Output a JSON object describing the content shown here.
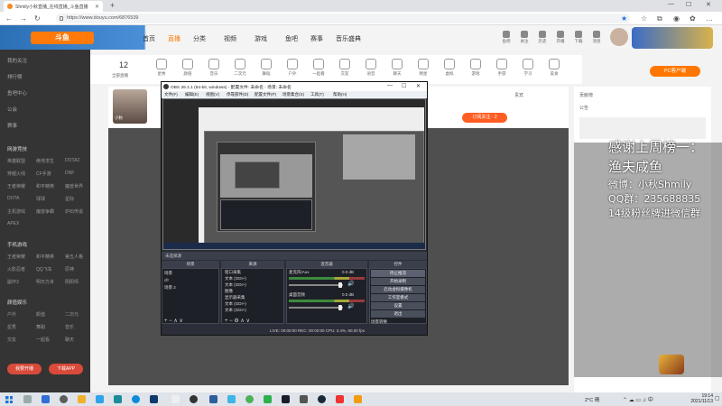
{
  "browser": {
    "tab_title": "Shmily小秋直播_在线直播_斗鱼直播",
    "url": "https://www.douyu.com/6876539"
  },
  "site": {
    "logo": "斗鱼",
    "nav": [
      "首页",
      "直播",
      "分类",
      "视频",
      "游戏",
      "鱼吧",
      "赛事",
      "音乐盛典"
    ],
    "search_placeholder": "",
    "header_icons": [
      "鱼吧",
      "关注",
      "历史",
      "开播",
      "下载",
      "消息"
    ],
    "pc_client_button": "PC客户端"
  },
  "sidebar": {
    "items": [
      "我的关注",
      "排行榜",
      "鱼吧中心",
      "公会",
      "赛事"
    ],
    "section1_title": "网游竞技",
    "section1_grid": [
      "英雄联盟",
      "绝地求生",
      "DOTA2",
      "穿越火线",
      "CF手游",
      "DNF",
      "王者荣耀",
      "和平精英",
      "魔兽世界",
      "DOTA",
      "球球",
      "星际",
      "主机游戏",
      "魔兽争霸",
      "炉石传说",
      "APEX"
    ],
    "section2_title": "手机游戏",
    "section2_grid": [
      "王者荣耀",
      "和平精英",
      "第五人格",
      "火影忍者",
      "QQ飞车",
      "原神",
      "崩坏3",
      "明日方舟",
      "阴阳师"
    ],
    "section3_title": "颜值娱乐",
    "section3_grid": [
      "户外",
      "颜值",
      "二次元",
      "星秀",
      "舞蹈",
      "音乐",
      "交友",
      "一起看",
      "聊天"
    ],
    "button_left": "我要开播",
    "button_right": "下载APP"
  },
  "category_bar": {
    "live_count": "12",
    "live_label": "全部直播",
    "items": [
      "星秀",
      "颜值",
      "音乐",
      "二次元",
      "舞蹈",
      "户外",
      "一起看",
      "交友",
      "语音",
      "聊天",
      "明星",
      "虚拟",
      "游戏",
      "手游",
      "学习",
      "美食",
      "科技"
    ]
  },
  "room": {
    "avatar_label": "小秋",
    "follow_button": "订阅关注 · 2",
    "rank_label": "贵宾",
    "top_fans_label": "贡献榜",
    "notice_label": "公告"
  },
  "overlay_text": [
    "感谢上周榜一：",
    "渔夫咸鱼",
    "微博：小秋Shmily",
    "QQ群：235688835",
    "14级粉丝牌进微信群"
  ],
  "obs": {
    "title": "OBS 26.1.1 (64-bit, windows) - 配置文件: 未命名 - 场景: 未命名",
    "menu": [
      "文件(F)",
      "编辑(E)",
      "视图(V)",
      "停靠部件(D)",
      "配置文件(P)",
      "场景集合(S)",
      "工具(T)",
      "帮助(H)"
    ],
    "scene_bar": "未选择源",
    "panel_headers": [
      "场景",
      "来源",
      "混音器",
      "控件"
    ],
    "scenes": [
      "场景",
      "cfr",
      "场景 2"
    ],
    "sources": [
      "窗口采集",
      "文本 (GDI+)",
      "文本 (GDI+)",
      "图像",
      "显示器采集",
      "文本 (GDI+)",
      "文本 (GDI+)"
    ],
    "mixer": [
      "麦克风/Aux",
      "桌面音频"
    ],
    "mixer_levels": [
      "0.0 dB",
      "0.0 dB"
    ],
    "controls": [
      "停止推流",
      "开始录制",
      "启动虚拟摄像机",
      "工作室模式",
      "设置",
      "退出"
    ],
    "transition_label": "场景转换",
    "status": "LIVE: 00:00:00   REC: 00:00:00   CPU: 3.4%, 60.00 fps"
  },
  "taskbar": {
    "weather": "2°C 晴",
    "time": "19:14",
    "date": "2021/11/13"
  },
  "colors": {
    "douyu_orange": "#ff7700",
    "douyu_red": "#ff5d23",
    "obs_bg": "#2b2e38"
  }
}
